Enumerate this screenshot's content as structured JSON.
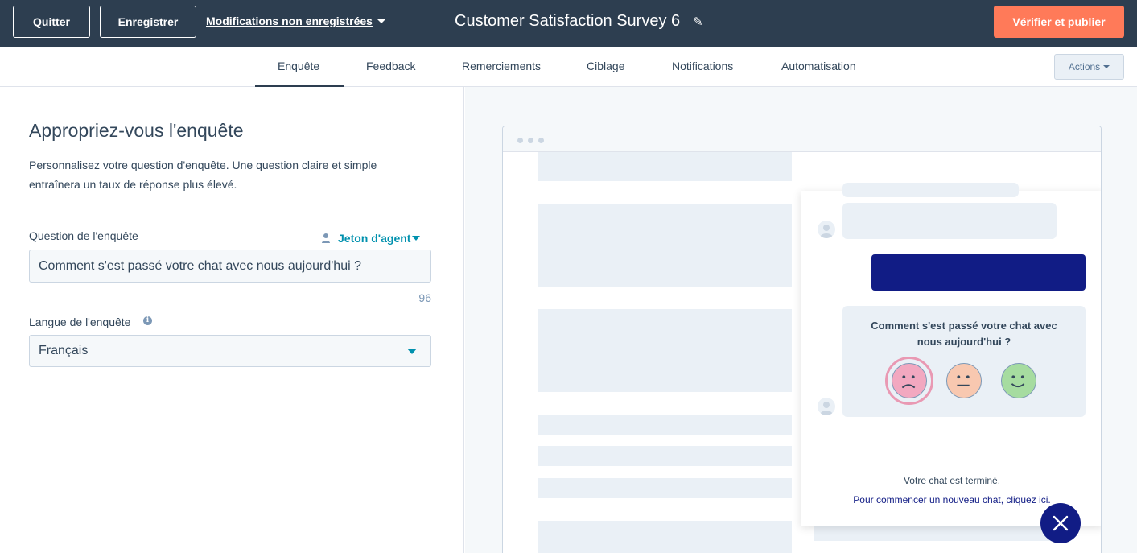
{
  "topbar": {
    "quit_label": "Quitter",
    "save_label": "Enregistrer",
    "unsaved_label": "Modifications non enregistrées",
    "title": "Customer Satisfaction Survey 6",
    "publish_label": "Vérifier et publier"
  },
  "tabs": [
    {
      "label": "Enquête",
      "active": true
    },
    {
      "label": "Feedback"
    },
    {
      "label": "Remerciements"
    },
    {
      "label": "Ciblage"
    },
    {
      "label": "Notifications"
    },
    {
      "label": "Automatisation"
    }
  ],
  "actions_label": "Actions",
  "editor": {
    "heading": "Appropriez-vous l'enquête",
    "description": "Personnalisez votre question d'enquête. Une question claire et simple entraînera un taux de réponse plus élevé.",
    "question_label": "Question de l'enquête",
    "token_label": "Jeton d'agent",
    "question_value": "Comment s'est passé votre chat avec nous aujourd'hui ?",
    "char_count": "96",
    "language_label": "Langue de l'enquête",
    "language_value": "Français"
  },
  "preview": {
    "survey_question": "Comment s'est passé votre chat avec nous aujourd'hui ?",
    "ended_text": "Votre chat est terminé.",
    "restart_link": "Pour commencer un nouveau chat, cliquez ici."
  },
  "colors": {
    "topbar": "#2d3e50",
    "accent_orange": "#ff7a59",
    "teal": "#0091ae",
    "chat_navy": "#111c85"
  }
}
